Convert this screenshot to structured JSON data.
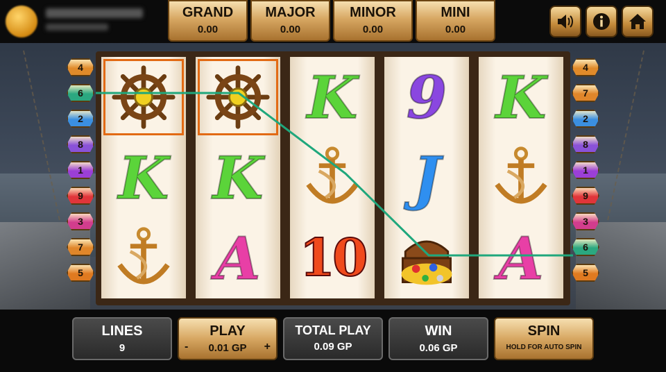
{
  "jackpots": [
    {
      "label": "GRAND",
      "value": "0.00"
    },
    {
      "label": "MAJOR",
      "value": "0.00"
    },
    {
      "label": "MINOR",
      "value": "0.00"
    },
    {
      "label": "MINI",
      "value": "0.00"
    }
  ],
  "controls": {
    "sound_icon": "speaker-icon",
    "info_icon": "info-icon",
    "home_icon": "home-icon"
  },
  "reels": [
    [
      "ship-wheel",
      "K",
      "anchor"
    ],
    [
      "ship-wheel",
      "K",
      "A"
    ],
    [
      "K",
      "anchor",
      "10"
    ],
    [
      "9",
      "J",
      "treasure-chest"
    ],
    [
      "K",
      "anchor",
      "A"
    ]
  ],
  "winning_cells": [
    [
      0,
      0
    ],
    [
      1,
      0
    ]
  ],
  "line_badges_left": [
    "4",
    "6",
    "2",
    "8",
    "1",
    "9",
    "3",
    "7",
    "5"
  ],
  "line_badges_right": [
    "4",
    "7",
    "2",
    "8",
    "1",
    "9",
    "3",
    "6",
    "5"
  ],
  "active_line": "6",
  "bottom": {
    "lines_label": "LINES",
    "lines_value": "9",
    "play_label": "PLAY",
    "play_value": "0.01 GP",
    "minus": "-",
    "plus": "+",
    "total_play_label": "TOTAL PLAY",
    "total_play_value": "0.09 GP",
    "win_label": "WIN",
    "win_value": "0.06 GP",
    "spin_label": "SPIN",
    "spin_sub": "HOLD FOR AUTO SPIN"
  },
  "colors": {
    "payline": "#1fa77c",
    "gold": "#d7a762",
    "win_outline": "#e26a14"
  }
}
